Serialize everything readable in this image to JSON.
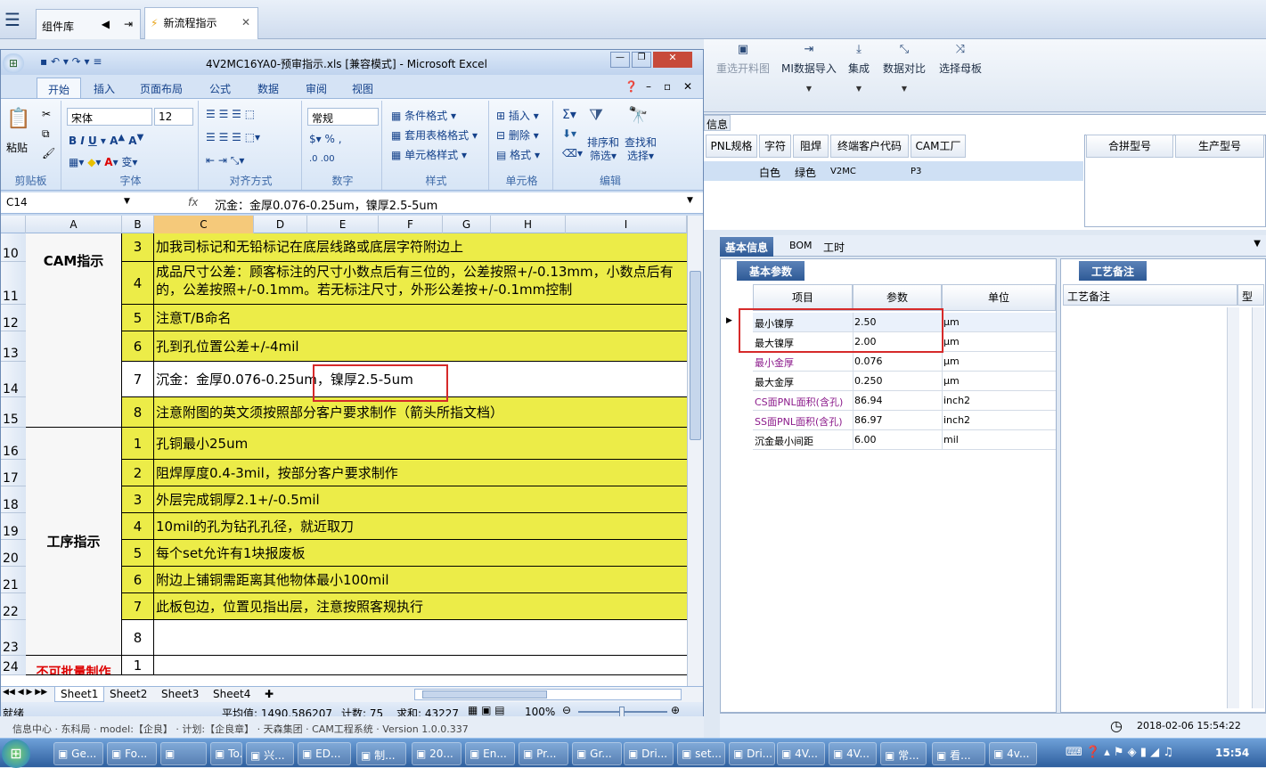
{
  "app": {
    "comp_tab": "组件库",
    "flow_tab": "新流程指示",
    "menu_icon": "hamburger-icon"
  },
  "ribbon2": {
    "buttons": [
      "重选开料图",
      "MI数据导入",
      "集成",
      "数据对比",
      "选择母板"
    ]
  },
  "info_fragment": "信息",
  "right_grid": {
    "headers": [
      "PNL规格",
      "字符",
      "阻焊",
      "终端客户代码",
      "CAM工厂"
    ],
    "row": [
      "白色",
      "绿色",
      "V2MC",
      "P3"
    ],
    "side_headers": [
      "合拼型号",
      "生产型号"
    ]
  },
  "right_tabs": [
    "基本信息",
    "BOM",
    "工时"
  ],
  "basic": {
    "title": "基本参数",
    "headers": [
      "项目",
      "参数",
      "单位"
    ],
    "rows": [
      {
        "item": "最小镍厚",
        "value": "2.50",
        "unit": "μm",
        "color": "#000000"
      },
      {
        "item": "最大镍厚",
        "value": "2.00",
        "unit": "μm",
        "color": "#000000"
      },
      {
        "item": "最小金厚",
        "value": "0.076",
        "unit": "μm",
        "color": "#8b1a8b"
      },
      {
        "item": "最大金厚",
        "value": "0.250",
        "unit": "μm",
        "color": "#000000"
      },
      {
        "item": "CS面PNL面积(含孔)",
        "value": "86.94",
        "unit": "inch2",
        "color": "#8b1a8b"
      },
      {
        "item": "SS面PNL面积(含孔)",
        "value": "86.97",
        "unit": "inch2",
        "color": "#8b1a8b"
      },
      {
        "item": "沉金最小间距",
        "value": "6.00",
        "unit": "mil",
        "color": "#000000"
      }
    ]
  },
  "remark": {
    "title": "工艺备注",
    "header": "工艺备注",
    "header2": "型"
  },
  "datetime": "2018-02-06 15:54:22",
  "excel": {
    "title": "4V2MC16YA0-预审指示.xls [兼容模式] - Microsoft Excel",
    "tabs": [
      "开始",
      "插入",
      "页面布局",
      "公式",
      "数据",
      "审阅",
      "视图"
    ],
    "groups": {
      "clipboard": "剪贴板",
      "font": "字体",
      "align": "对齐方式",
      "number": "数字",
      "style": "样式",
      "cells": "单元格",
      "edit": "编辑"
    },
    "paste": "粘贴",
    "font_name": "宋体",
    "font_size": "12",
    "num_format": "常规",
    "style_btns": [
      "条件格式",
      "套用表格格式",
      "单元格样式"
    ],
    "cell_btns": [
      "插入",
      "删除",
      "格式"
    ],
    "edit_btns": [
      "排序和",
      "筛选",
      "查找和",
      "选择"
    ],
    "name_box": "C14",
    "formula": "沉金：金厚0.076-0.25um，镍厚2.5-5um",
    "columns": [
      "A",
      "B",
      "C",
      "D",
      "E",
      "F",
      "G",
      "H",
      "I"
    ],
    "rows": [
      {
        "num": "10",
        "idx": "3",
        "text": "加我司标记和无铅标记在底层线路或底层字符附边上",
        "yellow": true
      },
      {
        "num": "11",
        "idx": "4",
        "text": "成品尺寸公差：顾客标注的尺寸小数点后有三位的，公差按照+/-0.13mm，小数点后有",
        "text2": "的，公差按照+/-0.1mm。若无标注尺寸，外形公差按+/-0.1mm控制",
        "yellow": true
      },
      {
        "num": "12",
        "idx": "5",
        "text": "注意T/B命名",
        "yellow": true
      },
      {
        "num": "13",
        "idx": "6",
        "text": "孔到孔位置公差+/-4mil",
        "yellow": true
      },
      {
        "num": "14",
        "idx": "7",
        "text": "沉金：金厚0.076-0.25um，镍厚2.5-5um",
        "yellow": false
      },
      {
        "num": "15",
        "idx": "8",
        "text": "注意附图的英文须按照部分客户要求制作（箭头所指文档）",
        "yellow": true
      },
      {
        "num": "16",
        "idx": "1",
        "text": "孔铜最小25um",
        "yellow": true
      },
      {
        "num": "17",
        "idx": "2",
        "text": "阻焊厚度0.4-3mil，按部分客户要求制作",
        "yellow": true
      },
      {
        "num": "18",
        "idx": "3",
        "text": "外层完成铜厚2.1+/-0.5mil",
        "yellow": true
      },
      {
        "num": "19",
        "idx": "4",
        "text": "10mil的孔为钻孔孔径，就近取刀",
        "yellow": true
      },
      {
        "num": "20",
        "idx": "5",
        "text": "每个set允许有1块报废板",
        "yellow": true
      },
      {
        "num": "21",
        "idx": "6",
        "text": "附边上铺铜需距离其他物体最小100mil",
        "yellow": true
      },
      {
        "num": "22",
        "idx": "7",
        "text": "此板包边，位置见指出层，注意按照客规执行",
        "yellow": true
      },
      {
        "num": "23",
        "idx": "8",
        "text": "",
        "yellow": false
      },
      {
        "num": "24",
        "idx": "1",
        "text": "",
        "yellow": false
      }
    ],
    "cat1": "CAM指示",
    "cat2": "工序指示",
    "cat3": "不可批量制作",
    "sheets": [
      "Sheet1",
      "Sheet2",
      "Sheet3",
      "Sheet4"
    ],
    "status": {
      "ready": "就绪",
      "avg": "平均值: 1490.586207",
      "count": "计数: 75",
      "sum": "求和: 43227",
      "zoom": "100%"
    }
  },
  "taskbar": {
    "items": [
      "Ge...",
      "Fo...",
      "",
      "To...",
      "兴...",
      "ED...",
      "制...",
      "20...",
      "En...",
      "Pr...",
      "Gr...",
      "Dri...",
      "set...",
      "Dri...",
      "4V...",
      "4V...",
      "常...",
      "看...",
      "4v..."
    ],
    "time": "15:54",
    "status_text": "信息中心 · 东科局 · model:【企良】 · 计划:【企良章】 · 天森集团 · CAM工程系统 · Version 1.0.0.337"
  }
}
